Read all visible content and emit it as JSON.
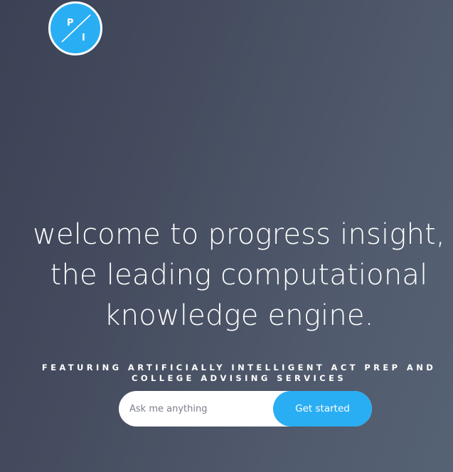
{
  "logo": {
    "letter_top": "P",
    "letter_bottom": "I",
    "color": "#2aaef3"
  },
  "hero": {
    "headline_lines": [
      "welcome to progress insight,",
      "the leading computational",
      "knowledge engine."
    ],
    "subheading": "FEATURING ARTIFICIALLY INTELLIGENT ACT PREP AND COLLEGE ADVISING SERVICES"
  },
  "search": {
    "placeholder": "Ask me anything",
    "value": "",
    "button_label": "Get started"
  },
  "colors": {
    "accent": "#2aaef3",
    "background_start": "#3c4255",
    "background_end": "#566275",
    "text": "#ffffff"
  }
}
